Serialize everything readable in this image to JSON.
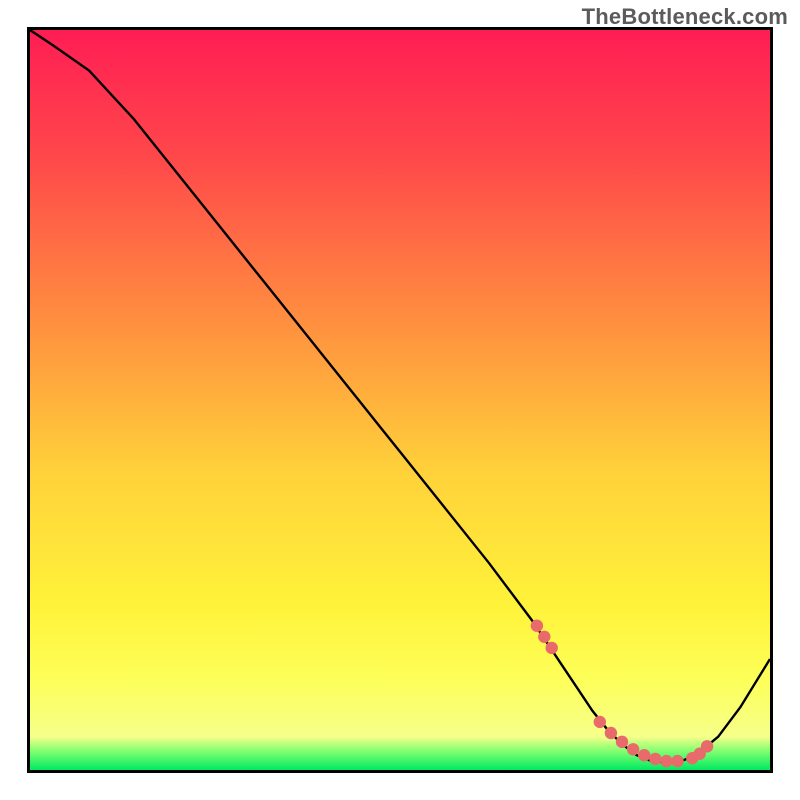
{
  "watermark": "TheBottleneck.com",
  "chart_data": {
    "type": "line",
    "title": "",
    "xlabel": "",
    "ylabel": "",
    "xlim": [
      0,
      100
    ],
    "ylim": [
      0,
      100
    ],
    "x": [
      0,
      3,
      8,
      14,
      20,
      26,
      32,
      38,
      44,
      50,
      56,
      62,
      68,
      70,
      72,
      74,
      76,
      78,
      80,
      82,
      84,
      86,
      88,
      90,
      93,
      96,
      100
    ],
    "values": [
      100,
      98,
      94.5,
      88,
      80.5,
      73,
      65.5,
      58,
      50.5,
      43,
      35.5,
      28,
      20,
      17,
      14,
      11,
      8,
      5.5,
      3.5,
      2,
      1.2,
      1,
      1.2,
      2,
      4.5,
      8.5,
      15
    ],
    "marker_x": [
      68.5,
      69.5,
      70.5,
      77,
      78.5,
      80,
      81.5,
      83,
      84.5,
      86,
      87.5,
      89.5,
      90.5,
      91.5
    ],
    "marker_y": [
      19.5,
      18,
      16.5,
      6.5,
      5,
      3.8,
      2.8,
      2,
      1.5,
      1.2,
      1.2,
      1.6,
      2.2,
      3.2
    ],
    "gradient_stops": [
      {
        "offset": 0.0,
        "color": "#ff1d54"
      },
      {
        "offset": 0.18,
        "color": "#ff4a4a"
      },
      {
        "offset": 0.4,
        "color": "#ff913f"
      },
      {
        "offset": 0.6,
        "color": "#ffd23a"
      },
      {
        "offset": 0.78,
        "color": "#fff33a"
      },
      {
        "offset": 0.88,
        "color": "#fdff5a"
      },
      {
        "offset": 0.955,
        "color": "#f6ff8a"
      },
      {
        "offset": 0.975,
        "color": "#7dff6f"
      },
      {
        "offset": 1.0,
        "color": "#00e963"
      }
    ],
    "marker_color": "#e96a6a",
    "curve_color": "#000000"
  }
}
